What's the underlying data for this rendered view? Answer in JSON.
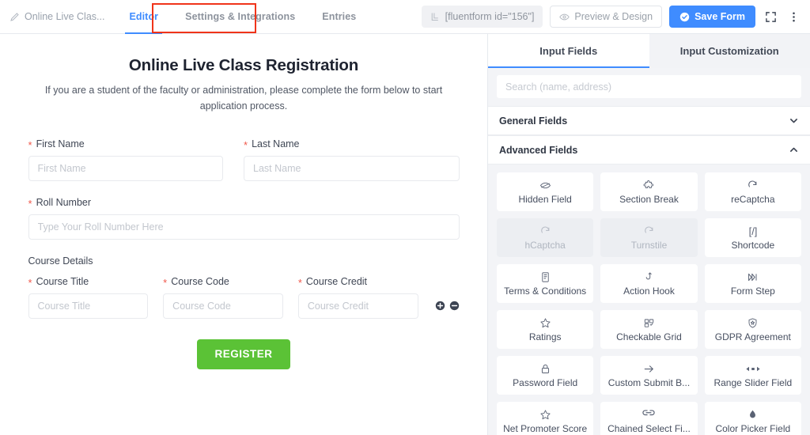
{
  "topbar": {
    "form_name": "Online Live Clas...",
    "pencil_icon": "pencil-icon",
    "tabs": [
      {
        "label": "Editor",
        "active": true,
        "highlight": false
      },
      {
        "label": "Settings & Integrations",
        "active": false,
        "highlight": true
      },
      {
        "label": "Entries",
        "active": false,
        "highlight": false
      }
    ],
    "shortcode": "[fluentform id=\"156\"]",
    "shortcode_icon": "shortcode-icon",
    "preview_label": "Preview & Design",
    "preview_icon": "eye-icon",
    "save_label": "Save Form",
    "save_icon": "check-circle-icon",
    "fullscreen_icon": "fullscreen-icon",
    "more_icon": "more-vertical-icon",
    "accent_color": "#3f8cff",
    "highlight_color": "#f0341a"
  },
  "form": {
    "title": "Online Live Class Registration",
    "description": "If you are a student of the faculty or administration, please complete the form below to start application process.",
    "fields": [
      {
        "label": "First Name",
        "required": true,
        "placeholder": "First Name",
        "name": "first-name"
      },
      {
        "label": "Last Name",
        "required": true,
        "placeholder": "Last Name",
        "name": "last-name"
      },
      {
        "label": "Roll Number",
        "required": true,
        "placeholder": "Type Your Roll Number Here",
        "name": "roll-number"
      }
    ],
    "section_label": "Course Details",
    "repeater": [
      {
        "label": "Course Title",
        "required": true,
        "placeholder": "Course Title",
        "name": "course-title"
      },
      {
        "label": "Course Code",
        "required": true,
        "placeholder": "Course Code",
        "name": "course-code"
      },
      {
        "label": "Course Credit",
        "required": true,
        "placeholder": "Course Credit",
        "name": "course-credit"
      }
    ],
    "repeater_add_icon": "plus-circle-icon",
    "repeater_remove_icon": "minus-circle-icon",
    "submit_label": "REGISTER",
    "submit_color": "#5bc236"
  },
  "panel": {
    "tabs": [
      {
        "label": "Input Fields",
        "active": true
      },
      {
        "label": "Input Customization",
        "active": false
      }
    ],
    "search_placeholder": "Search (name, address)",
    "search_value": "",
    "accordions": [
      {
        "label": "General Fields",
        "expanded": false,
        "chevron": "chevron-down-icon"
      },
      {
        "label": "Advanced Fields",
        "expanded": true,
        "chevron": "chevron-up-icon"
      }
    ],
    "advanced_fields": [
      {
        "label": "Hidden Field",
        "icon": "eye-slash-icon",
        "disabled": false
      },
      {
        "label": "Section Break",
        "icon": "puzzle-icon",
        "disabled": false
      },
      {
        "label": "reCaptcha",
        "icon": "refresh-icon",
        "disabled": false
      },
      {
        "label": "hCaptcha",
        "icon": "refresh-icon",
        "disabled": true
      },
      {
        "label": "Turnstile",
        "icon": "refresh-icon",
        "disabled": true
      },
      {
        "label": "Shortcode",
        "icon": "code-brackets-icon",
        "disabled": false
      },
      {
        "label": "Terms & Conditions",
        "icon": "document-icon",
        "disabled": false
      },
      {
        "label": "Action Hook",
        "icon": "hook-icon",
        "disabled": false
      },
      {
        "label": "Form Step",
        "icon": "steps-icon",
        "disabled": false
      },
      {
        "label": "Ratings",
        "icon": "star-icon",
        "disabled": false
      },
      {
        "label": "Checkable Grid",
        "icon": "grid-icon",
        "disabled": false
      },
      {
        "label": "GDPR Agreement",
        "icon": "shield-icon",
        "disabled": false
      },
      {
        "label": "Password Field",
        "icon": "lock-icon",
        "disabled": false
      },
      {
        "label": "Custom Submit B...",
        "icon": "arrow-right-icon",
        "disabled": false
      },
      {
        "label": "Range Slider Field",
        "icon": "slider-icon",
        "disabled": false
      },
      {
        "label": "Net Promoter Score",
        "icon": "star-icon",
        "disabled": false
      },
      {
        "label": "Chained Select Fi...",
        "icon": "link-icon",
        "disabled": false
      },
      {
        "label": "Color Picker Field",
        "icon": "droplet-icon",
        "disabled": false
      }
    ]
  }
}
